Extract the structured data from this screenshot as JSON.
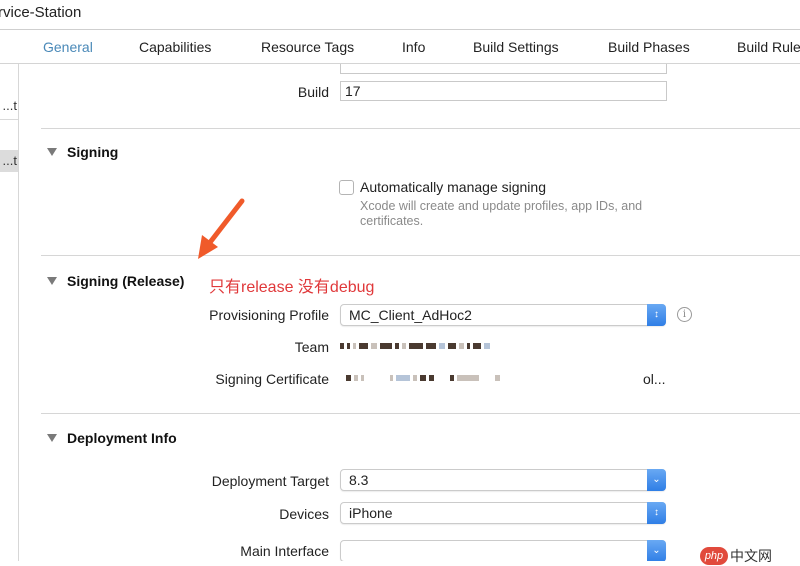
{
  "window": {
    "title": "rvice-Station"
  },
  "tabs": [
    {
      "label": "General",
      "active": true
    },
    {
      "label": "Capabilities",
      "active": false
    },
    {
      "label": "Resource Tags",
      "active": false
    },
    {
      "label": "Info",
      "active": false
    },
    {
      "label": "Build Settings",
      "active": false
    },
    {
      "label": "Build Phases",
      "active": false
    },
    {
      "label": "Build Rule",
      "active": false
    }
  ],
  "sidebar": {
    "items": [
      {
        "label": "t...",
        "selected": false
      },
      {
        "label": "t...",
        "selected": true
      }
    ]
  },
  "identity": {
    "build_label": "Build",
    "build_value": "17"
  },
  "signing": {
    "header": "Signing",
    "auto_manage_label": "Automatically manage signing",
    "auto_manage_checked": false,
    "auto_manage_hint": "Xcode will create and update profiles, app IDs, and certificates."
  },
  "signing_release": {
    "header": "Signing (Release)",
    "provisioning_profile_label": "Provisioning Profile",
    "provisioning_profile_value": "MC_Client_AdHoc2",
    "team_label": "Team",
    "team_value_redacted": true,
    "signing_certificate_label": "Signing Certificate",
    "signing_certificate_suffix": "ol..."
  },
  "annotation": {
    "text": "只有release 没有debug",
    "color": "#e0383a",
    "arrow_color": "#f05a2a"
  },
  "deployment": {
    "header": "Deployment Info",
    "target_label": "Deployment Target",
    "target_value": "8.3",
    "devices_label": "Devices",
    "devices_value": "iPhone",
    "main_interface_label": "Main Interface",
    "main_interface_value": ""
  },
  "watermark": {
    "logo": "php",
    "text": "中文网"
  },
  "colors": {
    "accent": "#4a89b8",
    "popup_button": "#3b86ea"
  }
}
